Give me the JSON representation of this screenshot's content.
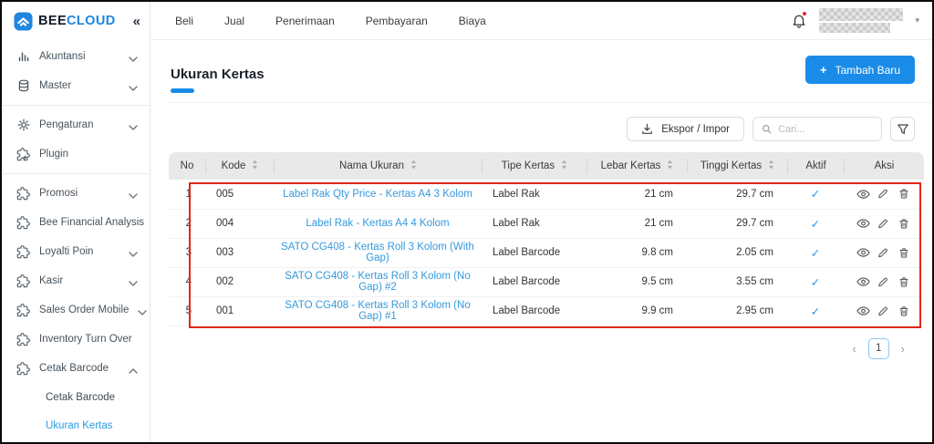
{
  "brand": {
    "bold": "BEE",
    "accent": "CLOUD",
    "collapse_glyph": "«"
  },
  "topnav": {
    "items": [
      "Beli",
      "Jual",
      "Penerimaan",
      "Pembayaran",
      "Biaya"
    ],
    "caret_glyph": "▾"
  },
  "sidebar": {
    "items": [
      {
        "label": "Akuntansi",
        "icon": "bar-chart-icon",
        "chevron": "down"
      },
      {
        "label": "Master",
        "icon": "database-icon",
        "chevron": "down",
        "divider_after": true
      },
      {
        "label": "Pengaturan",
        "icon": "gear-icon",
        "chevron": "down"
      },
      {
        "label": "Plugin",
        "icon": "puzzle-plus-icon",
        "divider_after": true
      },
      {
        "label": "Promosi",
        "icon": "puzzle-icon",
        "chevron": "down"
      },
      {
        "label": "Bee Financial Analysis",
        "icon": "puzzle-icon"
      },
      {
        "label": "Loyalti Poin",
        "icon": "puzzle-icon",
        "chevron": "down"
      },
      {
        "label": "Kasir",
        "icon": "puzzle-icon",
        "chevron": "down"
      },
      {
        "label": "Sales Order Mobile",
        "icon": "puzzle-icon",
        "chevron": "down"
      },
      {
        "label": "Inventory Turn Over",
        "icon": "puzzle-icon"
      },
      {
        "label": "Cetak Barcode",
        "icon": "puzzle-icon",
        "chevron": "up"
      },
      {
        "label": "Cetak Barcode",
        "sub": true
      },
      {
        "label": "Ukuran Kertas",
        "sub": true,
        "active": true
      }
    ]
  },
  "page": {
    "title": "Ukuran Kertas"
  },
  "actions": {
    "add_label": "Tambah Baru",
    "add_plus": "+",
    "export_label": "Ekspor / Impor",
    "search_placeholder": "Cari..."
  },
  "table": {
    "check_glyph": "✓",
    "columns": [
      {
        "key": "no",
        "label": "No",
        "sortable": false,
        "align": "right"
      },
      {
        "key": "kode",
        "label": "Kode",
        "sortable": true,
        "align": "left"
      },
      {
        "key": "nama",
        "label": "Nama Ukuran",
        "sortable": true,
        "align": "center",
        "link": true
      },
      {
        "key": "tipe",
        "label": "Tipe Kertas",
        "sortable": true,
        "align": "left"
      },
      {
        "key": "lebar",
        "label": "Lebar Kertas",
        "sortable": true,
        "align": "right"
      },
      {
        "key": "tinggi",
        "label": "Tinggi Kertas",
        "sortable": true,
        "align": "right"
      },
      {
        "key": "aktif",
        "label": "Aktif",
        "sortable": false,
        "align": "center"
      },
      {
        "key": "aksi",
        "label": "Aksi",
        "sortable": false,
        "align": "center"
      }
    ],
    "rows": [
      {
        "no": "1",
        "kode": "005",
        "nama": "Label Rak Qty Price - Kertas A4 3 Kolom",
        "tipe": "Label Rak",
        "lebar": "21 cm",
        "tinggi": "29.7 cm",
        "aktif": true
      },
      {
        "no": "2",
        "kode": "004",
        "nama": "Label Rak - Kertas A4 4 Kolom",
        "tipe": "Label Rak",
        "lebar": "21 cm",
        "tinggi": "29.7 cm",
        "aktif": true
      },
      {
        "no": "3",
        "kode": "003",
        "nama": "SATO CG408 - Kertas Roll 3 Kolom (With Gap)",
        "tipe": "Label Barcode",
        "lebar": "9.8 cm",
        "tinggi": "2.05 cm",
        "aktif": true
      },
      {
        "no": "4",
        "kode": "002",
        "nama": "SATO CG408 - Kertas Roll 3 Kolom (No Gap) #2",
        "tipe": "Label Barcode",
        "lebar": "9.5 cm",
        "tinggi": "3.55 cm",
        "aktif": true
      },
      {
        "no": "5",
        "kode": "001",
        "nama": "SATO CG408 - Kertas Roll 3 Kolom (No Gap) #1",
        "tipe": "Label Barcode",
        "lebar": "9.9 cm",
        "tinggi": "2.95 cm",
        "aktif": true
      }
    ]
  },
  "pagination": {
    "prev": "‹",
    "current": "1",
    "next": "›"
  },
  "colors": {
    "accent": "#1a8ce8",
    "link": "#3599db",
    "check": "#2196f3",
    "annotation": "#e1271b",
    "active_nav": "#2b9ce0",
    "notification_dot": "#f5222d"
  }
}
